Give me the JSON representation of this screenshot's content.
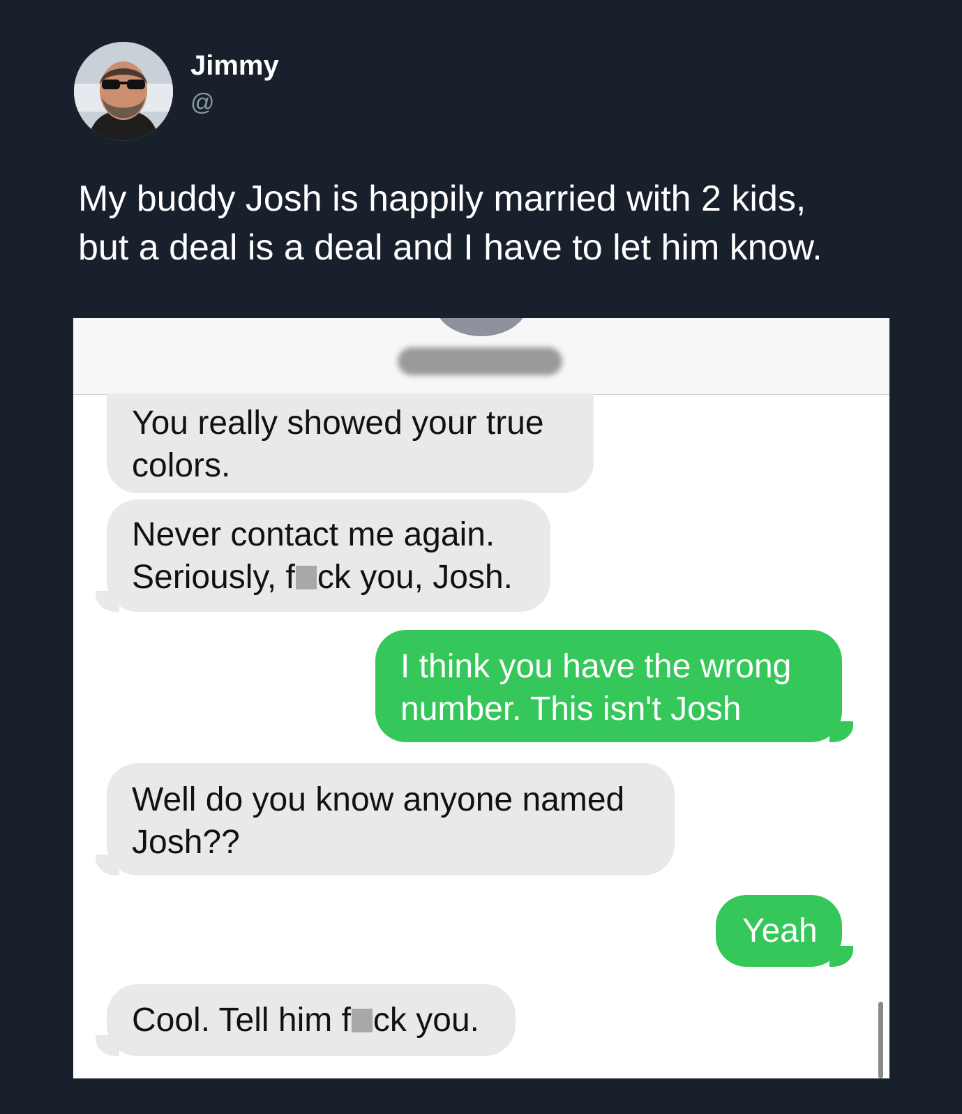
{
  "tweet": {
    "display_name": "Jimmy",
    "handle": "@",
    "avatar_icon": "profile-photo",
    "text_line1": "My buddy Josh is happily married with 2 kids,",
    "text_line2": "but a deal is a deal and I have to let him know."
  },
  "chat": {
    "header": {
      "contact_avatar_icon": "contact-avatar"
    },
    "messages": [
      {
        "direction": "received",
        "line1": "You really showed your true",
        "line2": "colors."
      },
      {
        "direction": "received",
        "line1": "Never contact me again.",
        "line2_a": "Seriously, f",
        "line2_b": "ck you, Josh."
      },
      {
        "direction": "sent",
        "line1": "I think you have the wrong",
        "line2": "number. This isn't Josh"
      },
      {
        "direction": "received",
        "line1": "Well do you know anyone named",
        "line2": "Josh??"
      },
      {
        "direction": "sent",
        "line1": "Yeah"
      },
      {
        "direction": "received",
        "line1_a": "Cool. Tell him f",
        "line1_b": "ck you."
      }
    ]
  },
  "colors": {
    "background": "#18202b",
    "received_bubble": "#e9e9eb",
    "sent_bubble": "#35c759"
  }
}
